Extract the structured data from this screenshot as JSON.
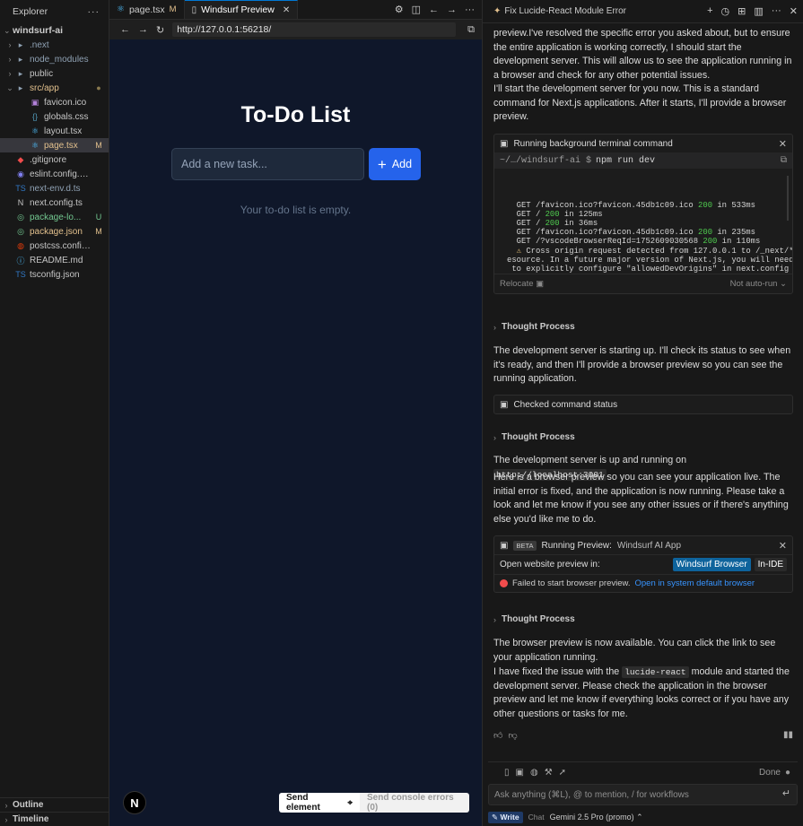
{
  "sidebar": {
    "title": "Explorer",
    "more": "···",
    "root": "windsurf-ai",
    "items": [
      {
        "label": ".next",
        "icon": "folder-icon",
        "color": "#8fa1b3",
        "chevron": "›",
        "depth": 0,
        "badge": "",
        "badge_color": ""
      },
      {
        "label": "node_modules",
        "icon": "folder-icon",
        "color": "#8fa1b3",
        "chevron": "›",
        "depth": 0,
        "badge": "",
        "badge_color": ""
      },
      {
        "label": "public",
        "icon": "folder-icon",
        "color": "#c5c5c5",
        "chevron": "›",
        "depth": 0,
        "badge": "",
        "badge_color": ""
      },
      {
        "label": "src/app",
        "icon": "folder-icon",
        "color": "#e2c08d",
        "chevron": "⌄",
        "depth": 0,
        "badge": "●",
        "badge_color": "#8a7a4f"
      },
      {
        "label": "favicon.ico",
        "icon": "image-icon",
        "color": "#c5c5c5",
        "chevron": "",
        "depth": 1,
        "badge": "",
        "badge_color": ""
      },
      {
        "label": "globals.css",
        "icon": "css-icon",
        "color": "#c5c5c5",
        "chevron": "",
        "depth": 1,
        "badge": "",
        "badge_color": ""
      },
      {
        "label": "layout.tsx",
        "icon": "react-icon",
        "color": "#c5c5c5",
        "chevron": "",
        "depth": 1,
        "badge": "",
        "badge_color": ""
      },
      {
        "label": "page.tsx",
        "icon": "react-icon",
        "color": "#e2c08d",
        "chevron": "",
        "depth": 1,
        "badge": "M",
        "badge_color": "#e2c08d",
        "selected": true
      },
      {
        "label": ".gitignore",
        "icon": "git-icon",
        "color": "#c5c5c5",
        "chevron": "",
        "depth": 0,
        "badge": "",
        "badge_color": ""
      },
      {
        "label": "eslint.config.mjs",
        "icon": "eslint-icon",
        "color": "#c5c5c5",
        "chevron": "",
        "depth": 0,
        "badge": "",
        "badge_color": ""
      },
      {
        "label": "next-env.d.ts",
        "icon": "ts-icon",
        "color": "#8fa1b3",
        "chevron": "",
        "depth": 0,
        "badge": "",
        "badge_color": ""
      },
      {
        "label": "next.config.ts",
        "icon": "next-icon",
        "color": "#c5c5c5",
        "chevron": "",
        "depth": 0,
        "badge": "",
        "badge_color": ""
      },
      {
        "label": "package-lo...",
        "icon": "package-icon",
        "color": "#73c991",
        "chevron": "",
        "depth": 0,
        "badge": "U",
        "badge_color": "#73c991"
      },
      {
        "label": "package.json",
        "icon": "package-icon",
        "color": "#e2c08d",
        "chevron": "",
        "depth": 0,
        "badge": "M",
        "badge_color": "#e2c08d"
      },
      {
        "label": "postcss.config....",
        "icon": "postcss-icon",
        "color": "#c5c5c5",
        "chevron": "",
        "depth": 0,
        "badge": "",
        "badge_color": ""
      },
      {
        "label": "README.md",
        "icon": "info-icon",
        "color": "#c5c5c5",
        "chevron": "",
        "depth": 0,
        "badge": "",
        "badge_color": ""
      },
      {
        "label": "tsconfig.json",
        "icon": "ts-icon",
        "color": "#c5c5c5",
        "chevron": "",
        "depth": 0,
        "badge": "",
        "badge_color": ""
      }
    ],
    "outline": "Outline",
    "timeline": "Timeline"
  },
  "editor": {
    "tabs": [
      {
        "label": "page.tsx",
        "badge": "M",
        "icon": "react-icon",
        "active": false
      },
      {
        "label": "Windsurf Preview",
        "badge": "",
        "icon": "file-icon",
        "active": true
      }
    ],
    "url": "http://127.0.0.1:56218/"
  },
  "app": {
    "title": "To-Do List",
    "input_placeholder": "Add a new task...",
    "add_label": "Add",
    "empty_message": "Your to-do list is empty.",
    "next_badge": "N",
    "send_element": "Send element",
    "send_console": "Send console errors (0)"
  },
  "chat": {
    "title": "Fix Lucide-React Module Error",
    "paragraphs": {
      "p1": "preview.I've resolved the specific error you asked about, but to ensure the entire application is working correctly, I should start the development server. This will allow us to see the application running in a browser and check for any other potential issues.",
      "p2": "I'll start the development server for you now. This is a standard command for Next.js applications. After it starts, I'll provide a browser preview.",
      "p3": "The development server is starting up. I'll check its status to see when it's ready, and then I'll provide a browser preview so you can see the running application.",
      "p4_before": "The development server is up and running on ",
      "p4_code": "http://localhost:3001",
      "p4_after": ".",
      "p5": "Here is a browser preview so you can see your application live. The initial error is fixed, and the application is now running. Please take a look and let me know if you see any other issues or if there's anything else you'd like me to do.",
      "p6": "The browser preview is now available. You can click the link to see your application running.",
      "p7_before": "I have fixed the issue with the ",
      "p7_code": "lucide-react",
      "p7_after": " module and started the development server. Please check the application in the browser preview and let me know if everything looks correct or if you have any other questions or tasks for me."
    },
    "terminal": {
      "header": "Running background terminal command",
      "prompt": "~/…/windsurf-ai $",
      "command": "npm run dev",
      "lines": [
        {
          "pre": "  GET /favicon.ico?favicon.45db1c09.ico ",
          "code": "200",
          "post": " in 533ms"
        },
        {
          "pre": "  GET / ",
          "code": "200",
          "post": " in 125ms"
        },
        {
          "pre": "  GET / ",
          "code": "200",
          "post": " in 36ms"
        },
        {
          "pre": "  GET /favicon.ico?favicon.45db1c09.ico ",
          "code": "200",
          "post": " in 235ms"
        },
        {
          "pre": "  GET /?vscodeBrowserReqId=1752609030568 ",
          "code": "200",
          "post": " in 110ms"
        },
        {
          "pre": "  ",
          "warn": "⚠",
          "post": " Cross origin request detected from 127.0.0.1 to /_next/* r"
        },
        {
          "pre": "esource. In a future major version of Next.js, you will need",
          "post": ""
        },
        {
          "pre": " to explicitly configure \"allowedDevOrigins\" in next.config to",
          "post": ""
        },
        {
          "pre": "  allow this.",
          "post": ""
        },
        {
          "pre": " Read more: https://nextjs.org/docs/app/api-reference/config/n",
          "post": ""
        },
        {
          "pre": "ext-config-js/allowedDevOrigins",
          "post": ""
        }
      ],
      "relocate": "Relocate",
      "auto_run": "Not auto-run"
    },
    "thought_label": "Thought Process",
    "checked_status": "Checked command status",
    "preview_card": {
      "beta": "BETA",
      "title": "Running Preview:",
      "app_name": "Windsurf AI App",
      "open_in": "Open website preview in:",
      "windsurf_browser": "Windsurf Browser",
      "in_ide": "In-IDE",
      "failed": "Failed to start browser preview.",
      "open_default": "Open in system default browser"
    },
    "composer": {
      "done": "Done",
      "placeholder": "Ask anything (⌘L), @ to mention, / for workflows",
      "write": "Write",
      "chat": "Chat",
      "model": "Gemini 2.5 Pro (promo)"
    }
  }
}
